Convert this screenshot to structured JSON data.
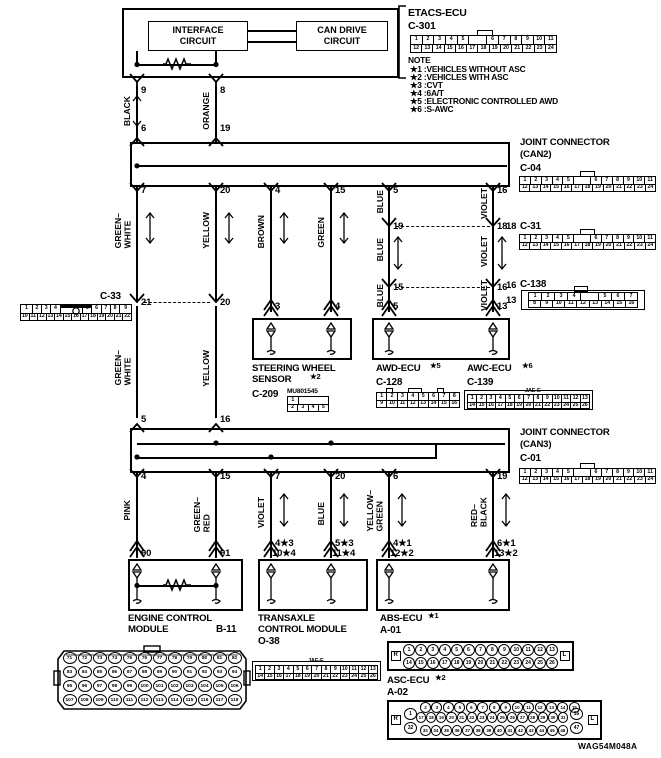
{
  "diagram": {
    "id_code": "WAG54M048A",
    "title_blocks": {
      "interface_circuit": "INTERFACE\nCIRCUIT",
      "can_drive_circuit": "CAN DRIVE\nCIRCUIT"
    },
    "note": {
      "heading": "NOTE",
      "items": [
        "★1 :VEHICLES WITHOUT ASC",
        "★2 :VEHICLES WITH ASC",
        "★3 :CVT",
        "★4 :6A/T",
        "★5 :ELECTRONIC CONTROLLED AWD",
        "★6 :S-AWC"
      ]
    },
    "components": {
      "etacs": {
        "name": "ETACS-ECU",
        "connector": "C-301"
      },
      "joint_can2": {
        "name": "JOINT CONNECTOR",
        "sub": "(CAN2)",
        "connector": "C-04"
      },
      "c31": {
        "connector": "C-31"
      },
      "c138": {
        "connector": "C-138"
      },
      "c33": {
        "connector": "C-33"
      },
      "steering": {
        "name": "STEERING WHEEL",
        "name2": "SENSOR",
        "star": "★2",
        "connector": "C-209",
        "part": "MU801545"
      },
      "awd": {
        "name": "AWD-ECU",
        "star": "★5",
        "connector": "C-128"
      },
      "awc": {
        "name": "AWC-ECU",
        "star": "★6",
        "connector": "C-139",
        "mark": "JAE-E"
      },
      "joint_can3": {
        "name": "JOINT CONNECTOR",
        "sub": "(CAN3)",
        "connector": "C-01"
      },
      "ecm": {
        "name": "ENGINE CONTROL",
        "name2": "MODULE",
        "connector": "B-11"
      },
      "tcm": {
        "name": "TRANSAXLE",
        "name2": "CONTROL MODULE",
        "connector": "O-38",
        "mark": "JAE-E"
      },
      "abs": {
        "name": "ABS-ECU",
        "star": "★1",
        "connector": "A-01"
      },
      "asc": {
        "name": "ASC-ECU",
        "star": "★2",
        "connector": "A-02"
      }
    },
    "wires": {
      "top": [
        {
          "color": "BLACK",
          "pin_top": "9",
          "pin_bot": "6"
        },
        {
          "color": "ORANGE",
          "pin_top": "8",
          "pin_bot": "19"
        }
      ],
      "middle": [
        {
          "color": "GREEN–\nWHITE",
          "pin_top": "7",
          "pin_bot": "21"
        },
        {
          "color": "YELLOW",
          "pin_top": "20",
          "pin_bot": "20"
        },
        {
          "color": "BROWN",
          "pin_top": "4",
          "pin_bot": "3"
        },
        {
          "color": "GREEN",
          "pin_top": "15",
          "pin_bot": "4"
        },
        {
          "color": "BLUE",
          "pin_top": "5",
          "pin_mid": "19",
          "pin_mid2": "15",
          "pin_bot": "5"
        },
        {
          "color": "VIOLET",
          "pin_top": "16",
          "pin_mid": "18",
          "pin_mid2": "16",
          "pin_bot": "13"
        }
      ],
      "lower_left_labels": [
        {
          "color": "GREEN–\nWHITE",
          "pin": "5"
        },
        {
          "color": "YELLOW",
          "pin": "16"
        }
      ],
      "bottom": [
        {
          "color": "PINK",
          "pin_top": "4",
          "pin_bot": "90"
        },
        {
          "color": "GREEN–\nRED",
          "pin_top": "15",
          "pin_bot": "91"
        },
        {
          "color": "VIOLET",
          "pin_top": "7",
          "pin_bot": "4★3",
          "pin_bot2": "10★4"
        },
        {
          "color": "BLUE",
          "pin_top": "20",
          "pin_bot": "5★3",
          "pin_bot2": "11★4"
        },
        {
          "color": "YELLOW–\nGREEN",
          "pin_top": "6",
          "pin_bot": "4★1",
          "pin_bot2": "12★2"
        },
        {
          "color": "RED–\nBLACK",
          "pin_top": "19",
          "pin_bot": "6★1",
          "pin_bot2": "13★2"
        }
      ]
    },
    "connectors": {
      "c301_row1": [
        "1",
        "2",
        "3",
        "4",
        "5",
        "6",
        "7",
        "8",
        "9",
        "10",
        "11"
      ],
      "c301_row2": [
        "12",
        "13",
        "14",
        "15",
        "16",
        "17",
        "18",
        "19",
        "20",
        "21",
        "22",
        "23",
        "24"
      ],
      "c04_row1": [
        "1",
        "2",
        "3",
        "4",
        "5",
        "6",
        "7",
        "8",
        "9",
        "10",
        "11"
      ],
      "c04_row2": [
        "12",
        "13",
        "14",
        "15",
        "16",
        "17",
        "18",
        "19",
        "20",
        "21",
        "22",
        "23",
        "24"
      ],
      "c31_row1": [
        "1",
        "2",
        "3",
        "4",
        "5",
        "6",
        "7",
        "8",
        "9",
        "10",
        "11"
      ],
      "c31_row2": [
        "12",
        "13",
        "14",
        "15",
        "16",
        "17",
        "18",
        "19",
        "20",
        "21",
        "22",
        "23",
        "24"
      ],
      "c138_row1": [
        "1",
        "2",
        "3",
        "4",
        "5",
        "6",
        "7"
      ],
      "c138_row2": [
        "8",
        "9",
        "10",
        "11",
        "12",
        "13",
        "14",
        "15",
        "16"
      ],
      "c33_row1": [
        "1",
        "2",
        "3",
        "4",
        "5",
        "6",
        "7",
        "8",
        "9"
      ],
      "c33_row2": [
        "10",
        "11",
        "12",
        "13",
        "14",
        "15",
        "16",
        "17",
        "18",
        "19",
        "20",
        "21",
        "22"
      ],
      "c209_row1": [
        "1"
      ],
      "c209_row2": [
        "2",
        "3",
        "4",
        "5"
      ],
      "c128_row1": [
        "1",
        "2",
        "3",
        "4",
        "5",
        "6",
        "7",
        "8"
      ],
      "c128_row2": [
        "9",
        "10",
        "11",
        "12",
        "13",
        "14",
        "15",
        "16"
      ],
      "c139_row1": [
        "1",
        "2",
        "3",
        "4",
        "5",
        "6",
        "7",
        "8",
        "9",
        "10",
        "11",
        "12",
        "13"
      ],
      "c139_row2": [
        "14",
        "15",
        "16",
        "17",
        "18",
        "19",
        "20",
        "21",
        "22",
        "23",
        "24",
        "25",
        "26"
      ],
      "c01_row1": [
        "1",
        "2",
        "3",
        "4",
        "5",
        "6",
        "7",
        "8",
        "9",
        "10",
        "11"
      ],
      "c01_row2": [
        "12",
        "13",
        "14",
        "15",
        "16",
        "17",
        "18",
        "19",
        "20",
        "21",
        "22",
        "23",
        "24"
      ],
      "o38_row1": [
        "1",
        "2",
        "3",
        "4",
        "5",
        "6",
        "7",
        "8",
        "9",
        "10",
        "11",
        "12",
        "13"
      ],
      "o38_row2": [
        "14",
        "15",
        "16",
        "17",
        "18",
        "19",
        "20",
        "21",
        "22",
        "23",
        "24",
        "25",
        "26"
      ],
      "b11_rows": [
        [
          "71",
          "72",
          "73",
          "74",
          "75",
          "76",
          "77",
          "78",
          "79",
          "80",
          "81",
          "82"
        ],
        [
          "83",
          "84",
          "85",
          "86",
          "87",
          "88",
          "89",
          "90",
          "91",
          "92",
          "93",
          "94"
        ],
        [
          "95",
          "96",
          "97",
          "98",
          "99",
          "100",
          "101",
          "102",
          "103",
          "104",
          "105",
          "106"
        ],
        [
          "107",
          "108",
          "109",
          "110",
          "111",
          "112",
          "113",
          "114",
          "115",
          "116",
          "117",
          "118"
        ]
      ],
      "a01_row1": [
        "1",
        "2",
        "3",
        "4",
        "5",
        "6",
        "7",
        "8",
        "9",
        "10",
        "11",
        "12",
        "13"
      ],
      "a01_row2": [
        "14",
        "15",
        "16",
        "17",
        "18",
        "19",
        "20",
        "21",
        "22",
        "23",
        "24",
        "25",
        "26"
      ],
      "a02_row1": [
        "1",
        "2",
        "3",
        "4",
        "5",
        "6",
        "7",
        "8",
        "9",
        "10",
        "11",
        "12",
        "13",
        "14",
        "15",
        "16"
      ],
      "a02_row2": [
        "17",
        "18",
        "19",
        "20",
        "21",
        "22",
        "23",
        "24",
        "25",
        "26",
        "27",
        "28",
        "29",
        "30",
        "31"
      ],
      "a02_row3": [
        "32",
        "33",
        "34",
        "35",
        "36",
        "37",
        "38",
        "39",
        "40",
        "41",
        "42",
        "43",
        "44",
        "45",
        "46",
        "47"
      ],
      "side_marks": {
        "left": "R",
        "right": "L"
      }
    },
    "pin_labels": {
      "c04_pin": "16",
      "c31_pin": "18",
      "c138_pin_a": "16",
      "c138_pin_b": "13",
      "c33_pin": "21"
    }
  }
}
